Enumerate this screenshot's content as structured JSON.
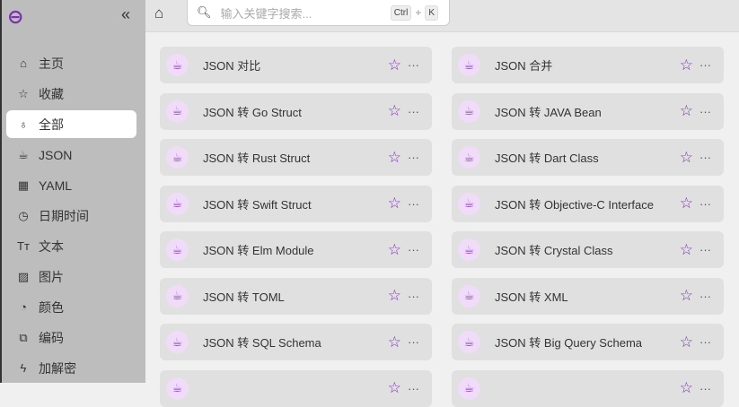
{
  "sidebar": {
    "items": [
      {
        "label": "主页",
        "icon": "home-icon",
        "glyph": "⌂"
      },
      {
        "label": "收藏",
        "icon": "star-icon",
        "glyph": "☆"
      },
      {
        "label": "全部",
        "icon": "rocket-icon",
        "glyph": "♁"
      },
      {
        "label": "JSON",
        "icon": "cup-icon",
        "glyph": "☕"
      },
      {
        "label": "YAML",
        "icon": "grid-icon",
        "glyph": "▦"
      },
      {
        "label": "日期时间",
        "icon": "clock-icon",
        "glyph": "◷"
      },
      {
        "label": "文本",
        "icon": "text-icon",
        "glyph": "Tт"
      },
      {
        "label": "图片",
        "icon": "image-icon",
        "glyph": "▨"
      },
      {
        "label": "颜色",
        "icon": "pie-icon",
        "glyph": "◔"
      },
      {
        "label": "编码",
        "icon": "encode-icon",
        "glyph": "⧉"
      },
      {
        "label": "加解密",
        "icon": "bolt-icon",
        "glyph": "ϟ"
      }
    ],
    "active": 2
  },
  "search": {
    "placeholder": "输入关键字搜索...",
    "key1": "Ctrl",
    "plus": "+",
    "key2": "K"
  },
  "tools": [
    "JSON 对比",
    "JSON 合并",
    "JSON 转 Go Struct",
    "JSON 转 JAVA Bean",
    "JSON 转 Rust Struct",
    "JSON 转 Dart Class",
    "JSON 转 Swift Struct",
    "JSON 转 Objective-C Interface",
    "JSON 转 Elm Module",
    "JSON 转 Crystal Class",
    "JSON 转 TOML",
    "JSON 转 XML",
    "JSON 转 SQL Schema",
    "JSON 转 Big Query Schema",
    "",
    ""
  ],
  "accent": "#7a2fb0"
}
